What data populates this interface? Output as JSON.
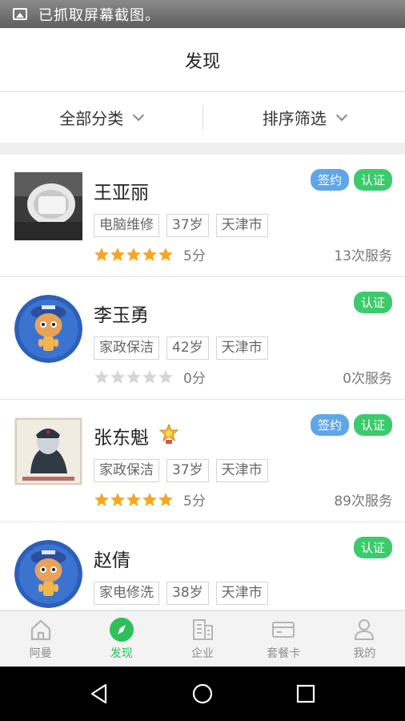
{
  "status_bar": {
    "message": "已抓取屏幕截图。",
    "icon": "image-icon"
  },
  "header": {
    "title": "发现"
  },
  "filters": [
    {
      "label": "全部分类"
    },
    {
      "label": "排序筛选"
    }
  ],
  "badge_labels": {
    "sign": "签约",
    "cert": "认证"
  },
  "providers": [
    {
      "name": "王亚丽",
      "signed": true,
      "certified": true,
      "medal": false,
      "tags": [
        "电脑维修",
        "37岁",
        "天津市"
      ],
      "rating": 5,
      "score": "5分",
      "services": "13次服务",
      "avatar": "photo-avatar"
    },
    {
      "name": "李玉勇",
      "signed": false,
      "certified": true,
      "medal": false,
      "tags": [
        "家政保洁",
        "42岁",
        "天津市"
      ],
      "rating": 0,
      "score": "0分",
      "services": "0次服务",
      "avatar": "default-avatar"
    },
    {
      "name": "张东魁",
      "signed": true,
      "certified": true,
      "medal": true,
      "tags": [
        "家政保洁",
        "37岁",
        "天津市"
      ],
      "rating": 5,
      "score": "5分",
      "services": "89次服务",
      "avatar": "portrait-avatar"
    },
    {
      "name": "赵倩",
      "signed": false,
      "certified": true,
      "medal": false,
      "tags": [
        "家电修洗",
        "38岁",
        "天津市"
      ],
      "rating": null,
      "score": "",
      "services": "",
      "avatar": "default-avatar"
    }
  ],
  "tabs": [
    {
      "label": "阿曼",
      "icon": "home-icon",
      "active": false
    },
    {
      "label": "发现",
      "icon": "discover-icon",
      "active": true
    },
    {
      "label": "企业",
      "icon": "building-icon",
      "active": false
    },
    {
      "label": "套餐卡",
      "icon": "card-icon",
      "active": false
    },
    {
      "label": "我的",
      "icon": "user-icon",
      "active": false
    }
  ],
  "colors": {
    "accent_green": "#2fbf5c",
    "sign_blue": "#5fa6e8",
    "cert_green": "#3ccb6c",
    "star_orange": "#f5a623",
    "star_empty": "#d6d6d6"
  }
}
